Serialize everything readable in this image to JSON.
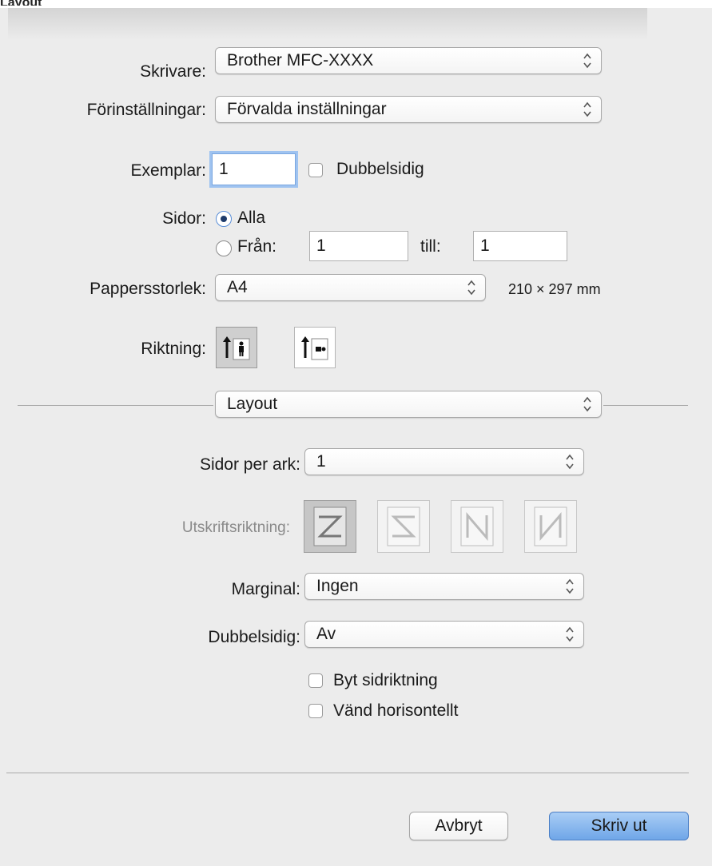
{
  "header": {
    "cut_title": "Layout"
  },
  "printer": {
    "label": "Skrivare:",
    "value": "Brother MFC-XXXX"
  },
  "presets": {
    "label": "Förinställningar:",
    "value": "Förvalda inställningar"
  },
  "copies": {
    "label": "Exemplar:",
    "value": "1",
    "duplex_label": "Dubbelsidig",
    "duplex_checked": false
  },
  "pages": {
    "label": "Sidor:",
    "all_label": "Alla",
    "all_selected": true,
    "from_label": "Från:",
    "from_value": "1",
    "to_label": "till:",
    "to_value": "1"
  },
  "paper": {
    "label": "Pappersstorlek:",
    "value": "A4",
    "dimensions": "210 × 297 mm"
  },
  "orientation": {
    "label": "Riktning:",
    "selected": "portrait",
    "options": [
      "portrait-icon",
      "landscape-icon"
    ]
  },
  "section": {
    "value": "Layout"
  },
  "layout": {
    "pages_per_sheet_label": "Sidor per ark:",
    "pages_per_sheet_value": "1",
    "direction_label": "Utskriftsriktning:",
    "directions": [
      "z-direction-icon",
      "reverse-z-direction-icon",
      "n-direction-icon",
      "reverse-n-direction-icon"
    ],
    "border_label": "Marginal:",
    "border_value": "Ingen",
    "duplex_label": "Dubbelsidig:",
    "duplex_value": "Av",
    "reverse_label": "Byt sidriktning",
    "reverse_checked": false,
    "flip_label": "Vänd horisontellt",
    "flip_checked": false
  },
  "buttons": {
    "cancel": "Avbryt",
    "print": "Skriv ut"
  },
  "colors": {
    "accent": "#6fa6e8",
    "focus": "#9fc3f0"
  }
}
